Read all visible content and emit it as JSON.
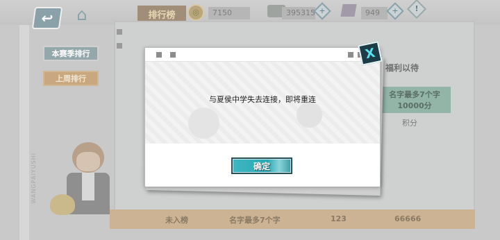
{
  "topbar": {
    "back_icon": "back-arrow-icon",
    "home_icon": "home-icon",
    "title": "排行榜",
    "coins": "7150",
    "money": "395315",
    "gems": "949",
    "info_icon": "info-icon"
  },
  "tabs": [
    {
      "label": "本赛季排行"
    },
    {
      "label": "上周排行"
    }
  ],
  "right_card": {
    "heading": "福利以待",
    "name": "名字最多7个字",
    "score": "10000分",
    "score_label": "积分"
  },
  "bottom_row": {
    "rank": "未入榜",
    "name": "名字最多7个字",
    "value1": "123",
    "value2": "66666"
  },
  "side_text": "WANGPAIYUSHI",
  "dialog": {
    "message": "与夏侯中学失去连接，即将重连",
    "ok_label": "确定",
    "close_label": "X"
  },
  "colors": {
    "accent": "#3fb7c2",
    "dialog_bg": "#ffffff",
    "dim_bg": "#c9c9c9"
  }
}
